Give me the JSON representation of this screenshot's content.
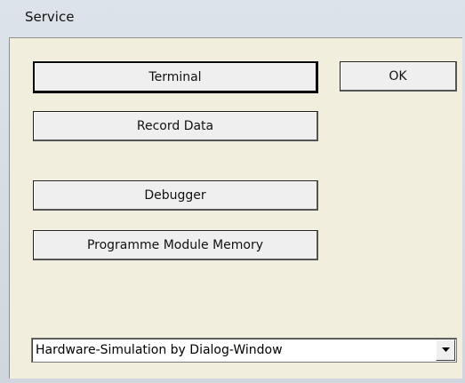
{
  "window": {
    "title": "Service"
  },
  "buttons": {
    "terminal": "Terminal",
    "ok": "OK",
    "record_data": "Record Data",
    "debugger": "Debugger",
    "programme_module_memory": "Programme Module Memory"
  },
  "simulation_select": {
    "selected": "Hardware-Simulation by Dialog-Window",
    "icon": "chevron-down-icon"
  },
  "colors": {
    "dialog_background": "#f2eedd",
    "title_bar": "#dde3ea",
    "button_face": "#efefef"
  }
}
